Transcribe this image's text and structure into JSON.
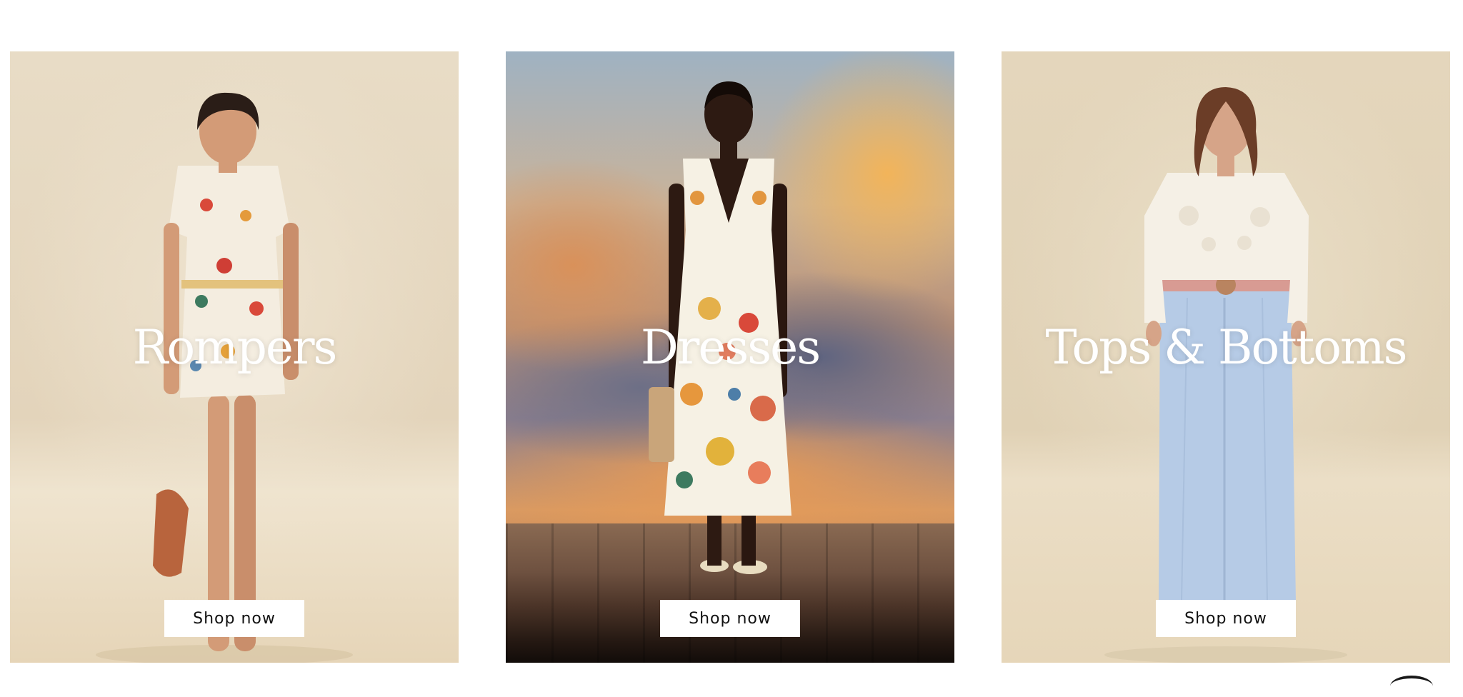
{
  "categories": [
    {
      "title": "Rompers",
      "button_label": "Shop now"
    },
    {
      "title": "Dresses",
      "button_label": "Shop now"
    },
    {
      "title": "Tops & Bottoms",
      "button_label": "Shop now"
    }
  ],
  "icons": {
    "corner": "partial-circle-icon"
  },
  "colors": {
    "page_background": "#ffffff",
    "title_text": "#ffffff",
    "button_background": "#ffffff",
    "button_text": "#111111"
  }
}
